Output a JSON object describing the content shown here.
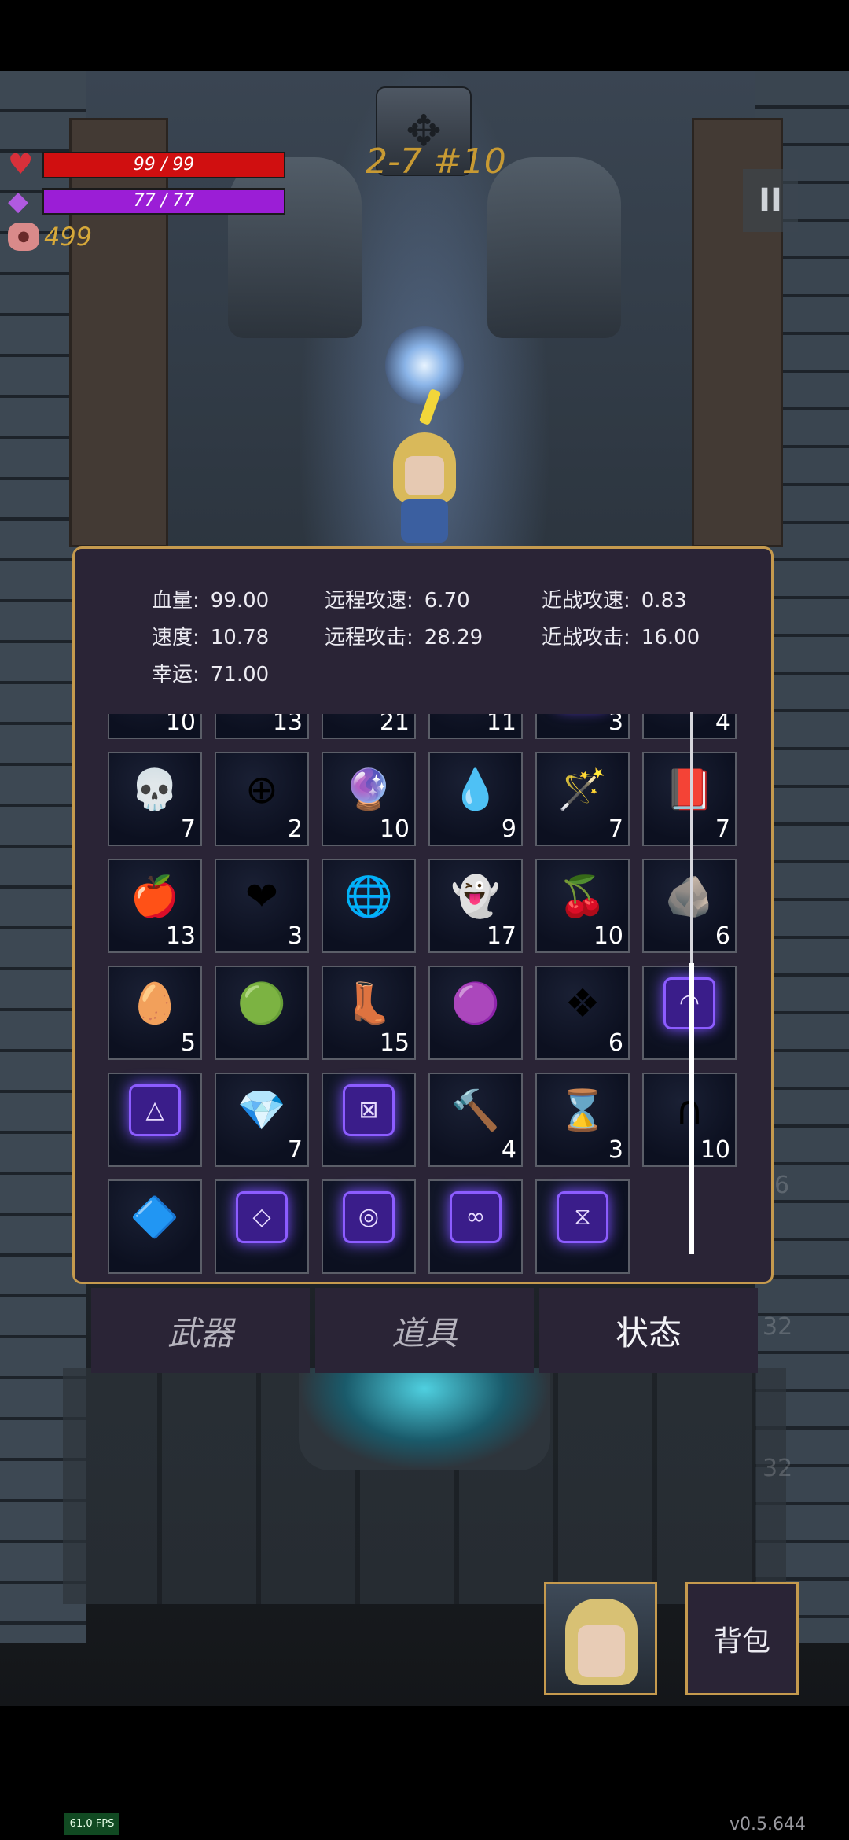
{
  "hud": {
    "hp_text": "99 / 99",
    "mp_text": "77 / 77",
    "coins": "499",
    "level": "2-7 #10"
  },
  "stats": {
    "hp_label": "血量:",
    "hp_value": "99.00",
    "ranged_speed_label": "远程攻速:",
    "ranged_speed_value": "6.70",
    "melee_speed_label": "近战攻速:",
    "melee_speed_value": "0.83",
    "speed_label": "速度:",
    "speed_value": "10.78",
    "ranged_attack_label": "远程攻击:",
    "ranged_attack_value": "28.29",
    "melee_attack_label": "近战攻击:",
    "melee_attack_value": "16.00",
    "luck_label": "幸运:",
    "luck_value": "71.00"
  },
  "inventory": [
    [
      {
        "icon": "crystal-shard-icon",
        "glyph": "🔹",
        "count": "10"
      },
      {
        "icon": "tombstone-icon",
        "glyph": "🪦",
        "count": "13"
      },
      {
        "icon": "claws-icon",
        "glyph": "🦀",
        "count": "21"
      },
      {
        "icon": "feather-icon",
        "glyph": "🪶",
        "count": "11"
      },
      {
        "icon": "rune-icon",
        "glyph": "⌖",
        "count": "3",
        "rune": true
      },
      {
        "icon": "ring-icon",
        "glyph": "◎",
        "count": "4"
      }
    ],
    [
      {
        "icon": "spiky-skull-icon",
        "glyph": "💀",
        "count": "7"
      },
      {
        "icon": "health-ring-icon",
        "glyph": "⊕",
        "count": "2"
      },
      {
        "icon": "purple-gem-icon",
        "glyph": "🔮",
        "count": "10"
      },
      {
        "icon": "water-drop-icon",
        "glyph": "💧",
        "count": "9"
      },
      {
        "icon": "wand-icon",
        "glyph": "🪄",
        "count": "7"
      },
      {
        "icon": "spellbook-icon",
        "glyph": "📕",
        "count": "7"
      }
    ],
    [
      {
        "icon": "apple-icon",
        "glyph": "🍎",
        "count": "13"
      },
      {
        "icon": "burning-heart-icon",
        "glyph": "❤",
        "count": "3"
      },
      {
        "icon": "energy-orb-icon",
        "glyph": "🌐",
        "count": ""
      },
      {
        "icon": "ghost-robe-icon",
        "glyph": "👻",
        "count": "17"
      },
      {
        "icon": "berries-icon",
        "glyph": "🍒",
        "count": "10"
      },
      {
        "icon": "stone-icon",
        "glyph": "🪨",
        "count": "6"
      }
    ],
    [
      {
        "icon": "egg-icon",
        "glyph": "🥚",
        "count": "5"
      },
      {
        "icon": "rainbow-orb-icon",
        "glyph": "🟢",
        "count": ""
      },
      {
        "icon": "boots-icon",
        "glyph": "👢",
        "count": "15"
      },
      {
        "icon": "slime-icon",
        "glyph": "🟣",
        "count": ""
      },
      {
        "icon": "crystal-frame-icon",
        "glyph": "❖",
        "count": "6"
      },
      {
        "icon": "rune-icon",
        "glyph": "◠",
        "count": "",
        "rune": true
      }
    ],
    [
      {
        "icon": "rune-icon",
        "glyph": "△",
        "count": "",
        "rune": true
      },
      {
        "icon": "green-crystal-icon",
        "glyph": "💎",
        "count": "7"
      },
      {
        "icon": "rune-icon",
        "glyph": "⊠",
        "count": "",
        "rune": true
      },
      {
        "icon": "hammer-icon",
        "glyph": "🔨",
        "count": "4"
      },
      {
        "icon": "hourglass-card-icon",
        "glyph": "⌛",
        "count": "3"
      },
      {
        "icon": "horseshoe-icon",
        "glyph": "∩",
        "count": "10"
      }
    ],
    [
      {
        "icon": "blue-card-icon",
        "glyph": "🔷",
        "count": ""
      },
      {
        "icon": "rune-icon",
        "glyph": "◇",
        "count": "",
        "rune": true
      },
      {
        "icon": "rune-icon",
        "glyph": "◎",
        "count": "",
        "rune": true
      },
      {
        "icon": "rune-icon",
        "glyph": "∞",
        "count": "",
        "rune": true
      },
      {
        "icon": "rune-icon",
        "glyph": "⧖",
        "count": "",
        "rune": true
      }
    ]
  ],
  "tabs": {
    "weapons": "武器",
    "items": "道具",
    "status": "状态"
  },
  "background_numbers": {
    "n1": "6",
    "n2": "32",
    "n3": "32"
  },
  "bag_label": "背包",
  "fps": "61.0 FPS",
  "version": "v0.5.644"
}
